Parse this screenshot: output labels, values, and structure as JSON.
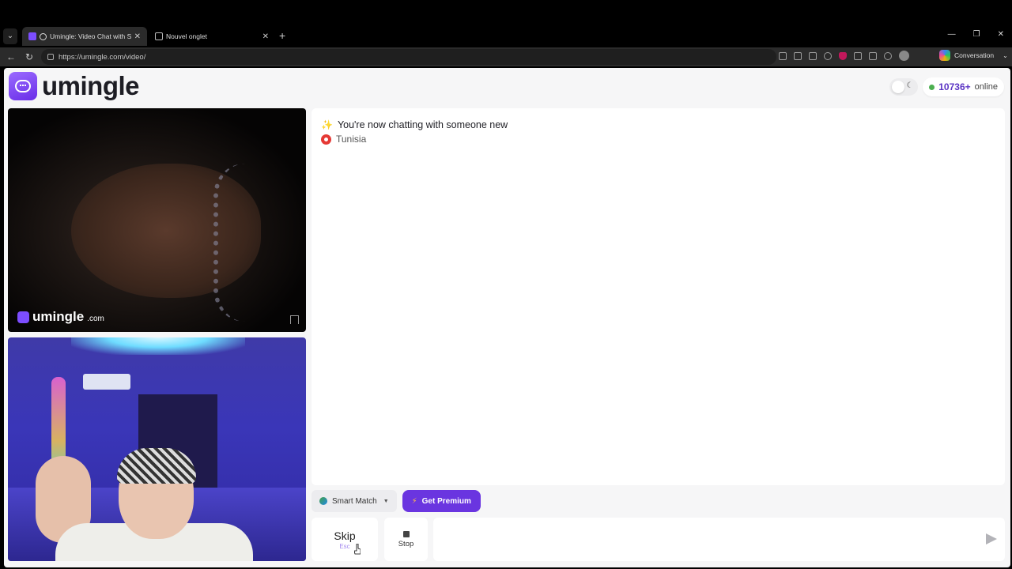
{
  "browser": {
    "tabs": [
      {
        "title": "Umingle: Video Chat with Stra",
        "active": true
      },
      {
        "title": "Nouvel onglet",
        "active": false
      }
    ],
    "url": "https://umingle.com/video/",
    "copilot_label": "Conversation"
  },
  "header": {
    "logo_text": "umingle",
    "online_count": "10736+",
    "online_label": "online"
  },
  "remote_video": {
    "watermark_name": "umingle",
    "watermark_tld": ".com"
  },
  "chat": {
    "status": "You're now chatting with someone new",
    "country": "Tunisia",
    "message_placeholder": ""
  },
  "controls": {
    "smart_match": "Smart Match",
    "premium": "Get Premium",
    "skip": "Skip",
    "skip_hint": "Esc",
    "stop": "Stop"
  },
  "colors": {
    "brand": "#6a35e0",
    "online": "#4caf50"
  }
}
